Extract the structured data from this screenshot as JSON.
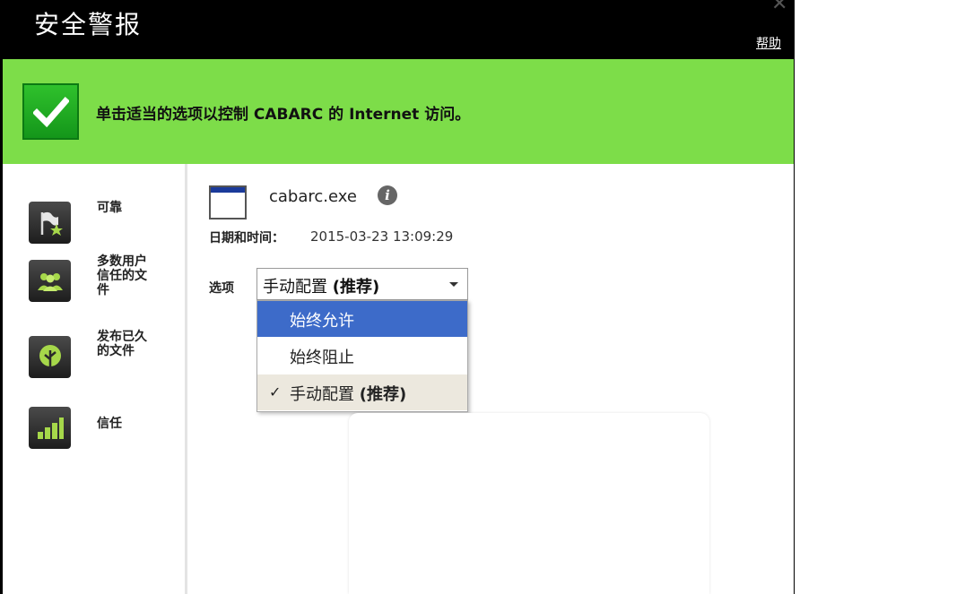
{
  "window": {
    "title": "安全警报",
    "help_label": "帮助",
    "close_glyph": "✕"
  },
  "banner": {
    "message": "单击适当的选项以控制 CABARC 的 Internet 访问。",
    "color": "#7ddd49"
  },
  "sidebar": {
    "items": [
      {
        "label": "可靠",
        "icon": "flag-star-icon"
      },
      {
        "label": "多数用户信任的文件",
        "icon": "users-group-icon"
      },
      {
        "label": "发布已久的文件",
        "icon": "tree-icon"
      },
      {
        "label": "信任",
        "icon": "signal-bars-icon"
      }
    ]
  },
  "file": {
    "name": "cabarc.exe",
    "date_label": "日期和时间：",
    "date_value": "2015-03-23 13:09:29"
  },
  "options": {
    "label": "选项",
    "selected_main": "手动配置",
    "selected_suffix": "(推荐)",
    "list": [
      {
        "label": "始终允许",
        "suffix": "",
        "state": "highlighted"
      },
      {
        "label": "始终阻止",
        "suffix": "",
        "state": "normal"
      },
      {
        "label": "手动配置",
        "suffix": "(推荐)",
        "state": "selected",
        "check": "✓"
      }
    ]
  },
  "colors": {
    "highlight": "#3d6bc9",
    "selected_bg": "#ece8de",
    "title_bg": "#000000"
  }
}
